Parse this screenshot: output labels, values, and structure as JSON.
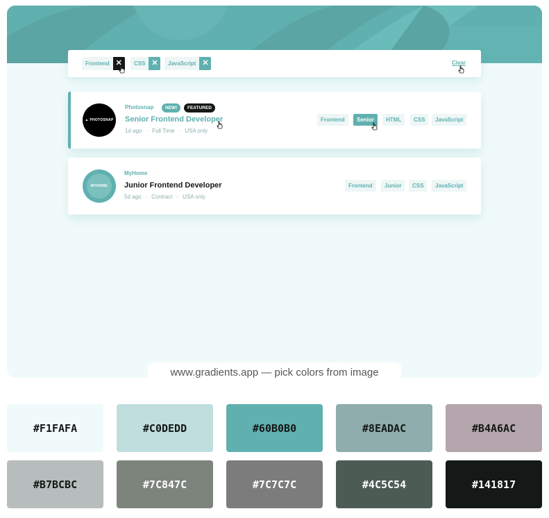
{
  "filters": {
    "chips": [
      {
        "label": "Frontend",
        "remove": "✕"
      },
      {
        "label": "CSS",
        "remove": "✕"
      },
      {
        "label": "JavaScript",
        "remove": "✕"
      }
    ],
    "clear_label": "Clear"
  },
  "jobs": [
    {
      "company": "Photosnap",
      "logo_text": "▲ PHOTOSNAP",
      "badges": [
        "NEW!",
        "FEATURED"
      ],
      "position": "Senior Frontend Developer",
      "posted": "1d ago",
      "contract": "Full Time",
      "location": "USA only",
      "tags": [
        "Frontend",
        "Senior",
        "HTML",
        "CSS",
        "JavaScript"
      ]
    },
    {
      "company": "MyHome",
      "logo_text": "MYHOME",
      "position": "Junior Frontend Developer",
      "posted": "5d ago",
      "contract": "Contract",
      "location": "USA only",
      "tags": [
        "Frontend",
        "Junior",
        "CSS",
        "JavaScript"
      ]
    }
  ],
  "meta_separator": "·",
  "caption": "www.gradients.app — pick colors from image",
  "palette": [
    {
      "label": "#F1FAFA",
      "color": "#F1FAFA"
    },
    {
      "label": "#C0DEDD",
      "color": "#C0DEDD"
    },
    {
      "label": "#60B0B0",
      "color": "#60B0B0"
    },
    {
      "label": "#8EADAC",
      "color": "#8EADAC"
    },
    {
      "label": "#B4A6AC",
      "color": "#B4A6AC"
    },
    {
      "label": "#B7BCBC",
      "color": "#B7BCBC"
    },
    {
      "label": "#7C847C",
      "color": "#7C847C"
    },
    {
      "label": "#7C7C7C",
      "color": "#7C7C7C"
    },
    {
      "label": "#4C5C54",
      "color": "#4C5C54"
    },
    {
      "label": "#141817",
      "color": "#141817"
    }
  ],
  "colors": {
    "primary": "#60B0B0",
    "background": "#F1FAFA",
    "dark": "#141817",
    "muted": "#8EADAC"
  }
}
